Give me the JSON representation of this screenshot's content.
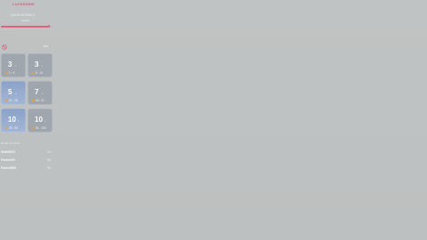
{
  "brand": {
    "name": "LUCKSHINE"
  },
  "round": {
    "title": "Unit 02 ROUND 2",
    "subtitle": "Ascent",
    "progress": 0.93,
    "progress_label": "- - - - - - - - - - -"
  },
  "header": {
    "right_text": "800"
  },
  "tiles": [
    {
      "value": "3",
      "unit": "x",
      "range": "1 - 5",
      "highlight": false
    },
    {
      "value": "3",
      "unit": "x",
      "range": "6 - 10",
      "highlight": false
    },
    {
      "value": "5",
      "unit": "x",
      "range": "11 - 15",
      "highlight": true
    },
    {
      "value": "7",
      "unit": "x",
      "range": "16 - 24",
      "highlight": false
    },
    {
      "value": "10",
      "unit": "x",
      "range": "25 - 50",
      "highlight": true
    },
    {
      "value": "10",
      "unit": "x",
      "range": "51 - 100",
      "highlight": false
    }
  ],
  "leaderboard": {
    "title": "Ronde 10 beste",
    "rows": [
      {
        "name": "Sbatik003",
        "value": "1x"
      },
      {
        "name": "Pasko400",
        "value": "2x"
      },
      {
        "name": "Paulo4888",
        "value": "3x"
      }
    ]
  },
  "colors": {
    "accent": "#d9657f",
    "tile": "#9fa6ae",
    "tile_highlight": "#8aa2c8",
    "coin": "#e7a23c",
    "background": "#c0c3c3"
  }
}
